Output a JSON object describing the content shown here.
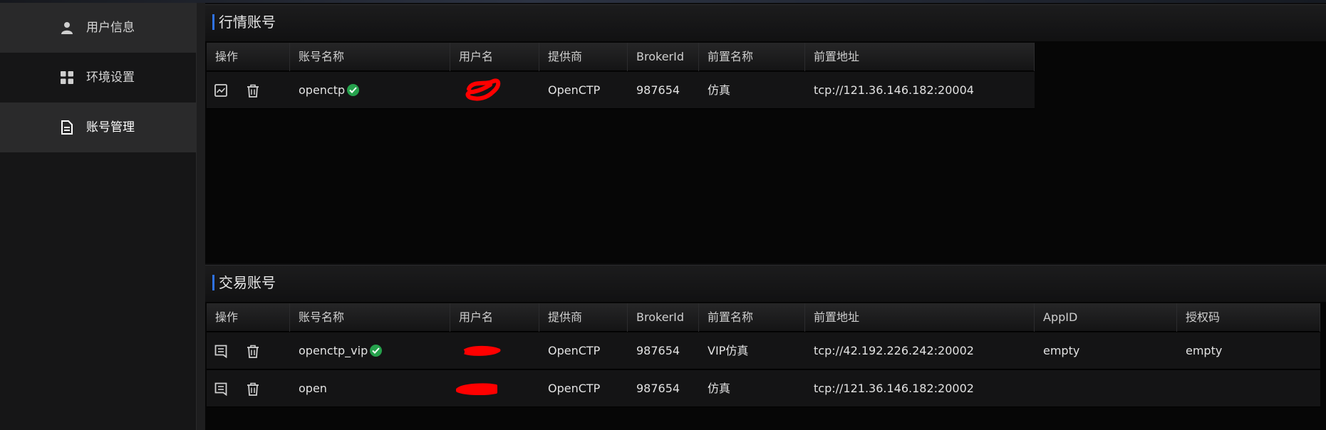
{
  "sidebar": {
    "items": [
      {
        "label": "用户信息",
        "icon": "user-icon"
      },
      {
        "label": "环境设置",
        "icon": "grid-icon"
      },
      {
        "label": "账号管理",
        "icon": "document-icon"
      }
    ]
  },
  "quote_panel": {
    "title": "行情账号",
    "headers": [
      "操作",
      "账号名称",
      "用户名",
      "提供商",
      "BrokerId",
      "前置名称",
      "前置地址"
    ],
    "rows": [
      {
        "account_name": "openctp",
        "connected": true,
        "provider": "OpenCTP",
        "broker_id": "987654",
        "front_name": "仿真",
        "front_address": "tcp://121.36.146.182:20004"
      }
    ]
  },
  "trade_panel": {
    "title": "交易账号",
    "headers": [
      "操作",
      "账号名称",
      "用户名",
      "提供商",
      "BrokerId",
      "前置名称",
      "前置地址",
      "AppID",
      "授权码"
    ],
    "rows": [
      {
        "account_name": "openctp_vip",
        "connected": true,
        "provider": "OpenCTP",
        "broker_id": "987654",
        "front_name": "VIP仿真",
        "front_address": "tcp://42.192.226.242:20002",
        "app_id": "empty",
        "auth_code": "empty"
      },
      {
        "account_name": "open",
        "connected": false,
        "provider": "OpenCTP",
        "broker_id": "987654",
        "front_name": "仿真",
        "front_address": "tcp://121.36.146.182:20002",
        "app_id": "",
        "auth_code": ""
      }
    ]
  },
  "colors": {
    "accent": "#2f72e6",
    "status_ok": "#25a14c",
    "redaction": "#ff0000"
  }
}
